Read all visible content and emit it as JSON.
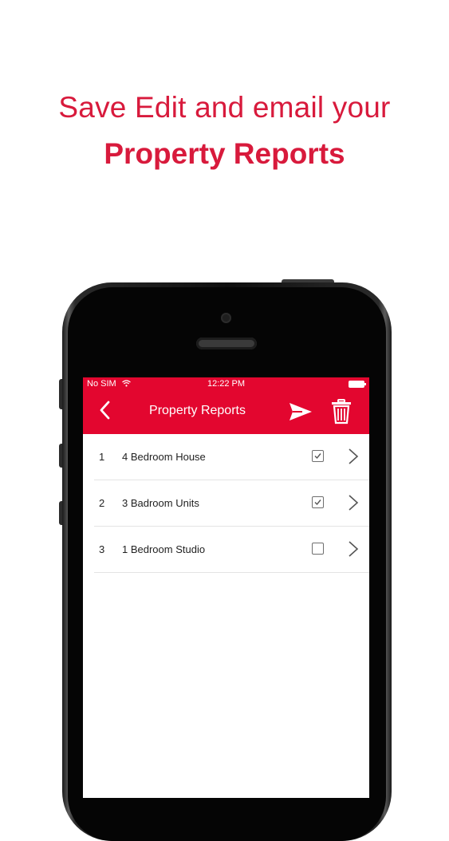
{
  "headline": {
    "line1": "Save Edit and email your",
    "line2": "Property Reports"
  },
  "status_bar": {
    "carrier": "No SIM",
    "time": "12:22 PM"
  },
  "nav_bar": {
    "title": "Property Reports",
    "back_icon": "chevron-left-icon",
    "send_icon": "send-icon",
    "delete_icon": "trash-icon"
  },
  "reports": [
    {
      "index": "1",
      "name": "4 Bedroom House",
      "checked": true
    },
    {
      "index": "2",
      "name": "3 Badroom Units",
      "checked": true
    },
    {
      "index": "3",
      "name": "1 Bedroom Studio",
      "checked": false
    }
  ],
  "colors": {
    "accent": "#e3062f",
    "headline": "#d81a3c"
  }
}
